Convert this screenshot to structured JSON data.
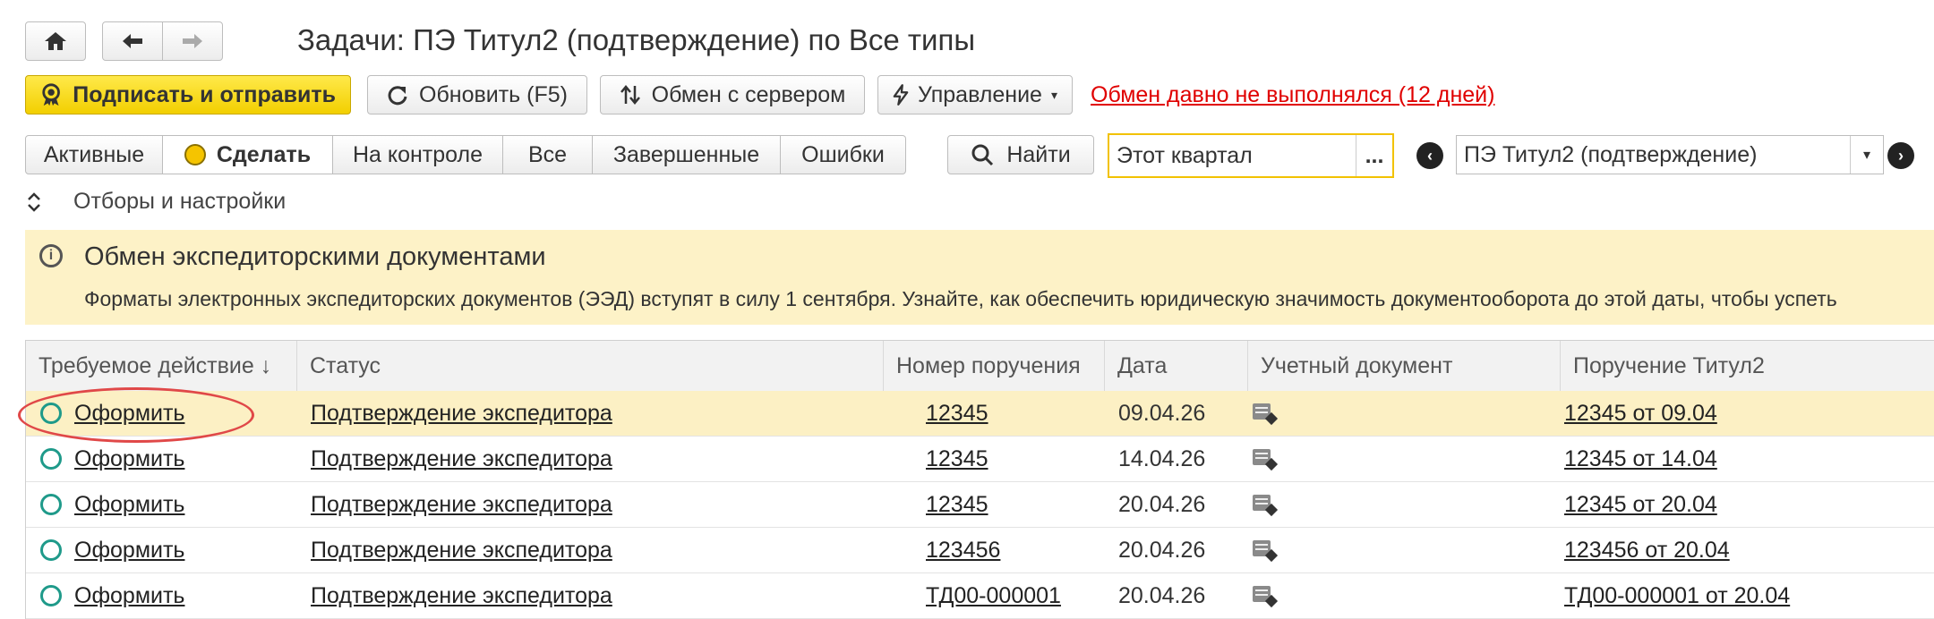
{
  "window": {
    "title": "Задачи: ПЭ Титул2 (подтверждение) по Все типы"
  },
  "nav": {
    "home_icon": "home-icon",
    "back_icon": "arrow-left-icon",
    "forward_icon": "arrow-right-icon"
  },
  "toolbar": {
    "sign_send_label": "Подписать и отправить",
    "refresh_label": "Обновить (F5)",
    "exchange_label": "Обмен с сервером",
    "manage_label": "Управление",
    "alert_text": "Обмен давно не выполнялся (12 дней)"
  },
  "tabs": [
    {
      "label": "Активные"
    },
    {
      "label": "Сделать"
    },
    {
      "label": "На контроле"
    },
    {
      "label": "Все"
    },
    {
      "label": "Завершенные"
    },
    {
      "label": "Ошибки"
    }
  ],
  "search": {
    "button_label": "Найти"
  },
  "period": {
    "value": "Этот квартал",
    "dots_label": "..."
  },
  "type_select": {
    "value": "ПЭ Титул2 (подтверждение)"
  },
  "filters": {
    "label": "Отборы и настройки"
  },
  "banner": {
    "title": "Обмен экспедиторскими документами",
    "text": "Форматы электронных экспедиторских документов (ЭЭД) вступят в силу 1 сентября. Узнайте, как обеспечить юридическую значимость документооборота до этой даты, чтобы успеть"
  },
  "table": {
    "columns": [
      "Требуемое действие ↓",
      "Статус",
      "Номер поручения",
      "Дата",
      "Учетный документ",
      "Поручение Титул2"
    ],
    "rows": [
      {
        "action": "Оформить",
        "status": "Подтверждение экспедитора",
        "number": "12345",
        "date": "09.04.26",
        "order": "12345 от 09.04"
      },
      {
        "action": "Оформить",
        "status": "Подтверждение экспедитора",
        "number": "12345",
        "date": "14.04.26",
        "order": "12345 от 14.04"
      },
      {
        "action": "Оформить",
        "status": "Подтверждение экспедитора",
        "number": "12345",
        "date": "20.04.26",
        "order": "12345 от 20.04"
      },
      {
        "action": "Оформить",
        "status": "Подтверждение экспедитора",
        "number": "123456",
        "date": "20.04.26",
        "order": "123456 от 20.04"
      },
      {
        "action": "Оформить",
        "status": "Подтверждение экспедитора",
        "number": "ТД00-000001",
        "date": "20.04.26",
        "order": "ТД00-000001 от 20.04"
      }
    ]
  },
  "colors": {
    "accent_yellow": "#f5d800",
    "alert_red": "#e00000",
    "banner_bg": "#fdf2c7",
    "selected_row": "#fcf0c4",
    "ring_teal": "#1f9a8a",
    "highlight_oval": "#e04848"
  }
}
